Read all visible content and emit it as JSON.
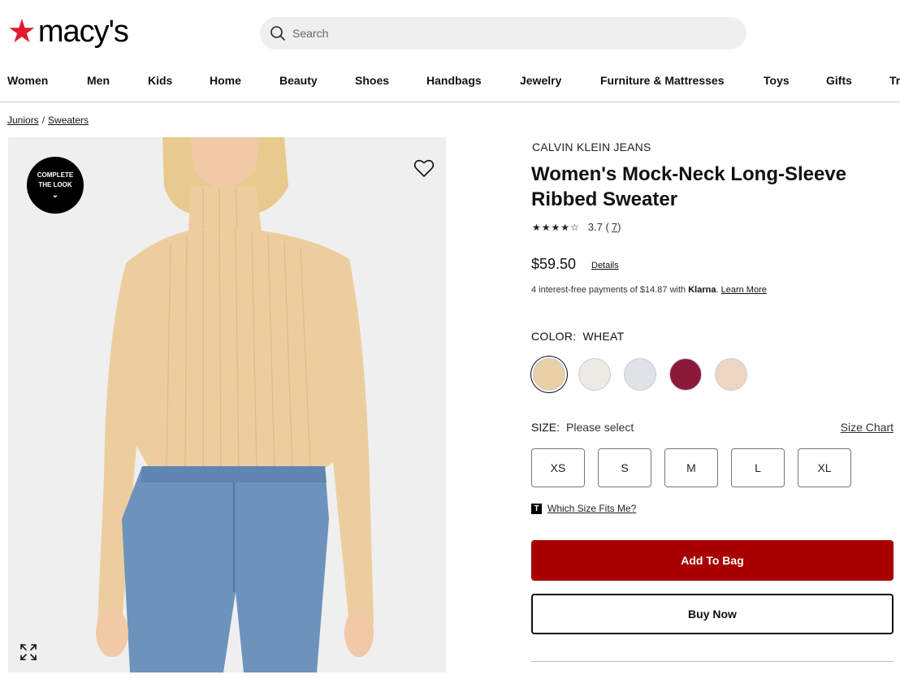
{
  "header": {
    "logo_text": "macy's",
    "search_placeholder": "Search"
  },
  "nav": [
    "Women",
    "Men",
    "Kids",
    "Home",
    "Beauty",
    "Shoes",
    "Handbags",
    "Jewelry",
    "Furniture & Mattresses",
    "Toys",
    "Gifts",
    "Tr"
  ],
  "breadcrumb": [
    "Juniors",
    "Sweaters"
  ],
  "image": {
    "complete_look_line1": "COMPLETE",
    "complete_look_line2": "THE LOOK"
  },
  "product": {
    "brand": "CALVIN KLEIN JEANS",
    "title": "Women's Mock-Neck Long-Sleeve Ribbed Sweater",
    "stars": "★★★★☆",
    "rating": "3.7",
    "review_count": "7",
    "price": "$59.50",
    "details_label": "Details",
    "klarna_text": "4 interest-free payments of $14.87 with",
    "klarna_brand": "Klarna",
    "klarna_learn": "Learn More"
  },
  "color": {
    "label": "COLOR:",
    "selected": "WHEAT",
    "swatches": [
      "#e9cfa5",
      "#ecebe6",
      "#dfe2e6",
      "#8b1a3a",
      "#eed6c4"
    ]
  },
  "size": {
    "label": "SIZE:",
    "placeholder": "Please select",
    "chart_label": "Size Chart",
    "options": [
      "XS",
      "S",
      "M",
      "L",
      "XL"
    ],
    "fit_label": "Which Size Fits Me?"
  },
  "actions": {
    "add_to_bag": "Add To Bag",
    "buy_now": "Buy Now"
  }
}
